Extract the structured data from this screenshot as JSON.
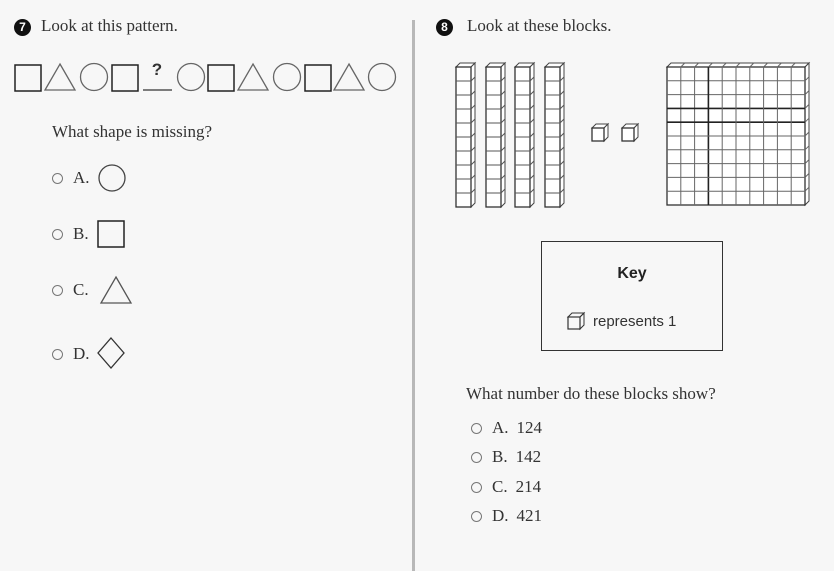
{
  "questions": [
    {
      "number": "7",
      "prompt": "Look at this pattern.",
      "pattern": [
        "square",
        "triangle",
        "circle",
        "square",
        "blank",
        "circle",
        "square",
        "triangle",
        "circle",
        "square",
        "triangle",
        "circle"
      ],
      "blank_label": "?",
      "question": "What shape is missing?",
      "options": [
        {
          "letter": "A.",
          "shape": "circle"
        },
        {
          "letter": "B.",
          "shape": "square"
        },
        {
          "letter": "C.",
          "shape": "triangle"
        },
        {
          "letter": "D.",
          "shape": "diamond"
        }
      ]
    },
    {
      "number": "8",
      "prompt": "Look at these blocks.",
      "blocks": {
        "hundreds": 1,
        "tens": 4,
        "ones": 2
      },
      "key": {
        "title": "Key",
        "text": "represents 1"
      },
      "question": "What number do these blocks show?",
      "options": [
        {
          "letter": "A.",
          "value": "124"
        },
        {
          "letter": "B.",
          "value": "142"
        },
        {
          "letter": "C.",
          "value": "214"
        },
        {
          "letter": "D.",
          "value": "421"
        }
      ]
    }
  ]
}
